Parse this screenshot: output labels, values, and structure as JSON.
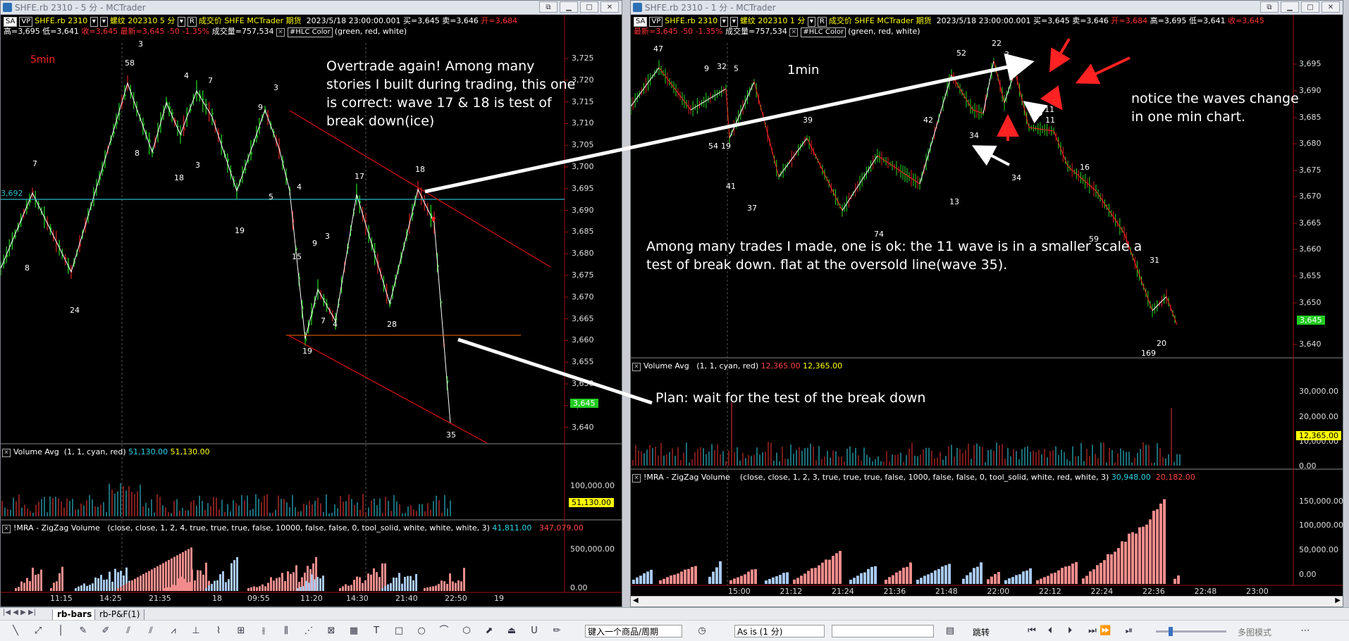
{
  "left_window": {
    "title": "SHFE.rb 2310 - 5 分 - MCTrader",
    "info_row1": [
      "SA",
      "VP",
      "SHFE.rb 2310",
      "螺纹",
      "202310",
      "5 分",
      "R",
      "成交价",
      "SHFE",
      "MCTrader",
      "期货",
      "2023/5/18",
      "23:00:00.001",
      "买=3,645",
      "卖=3,646",
      "开=3,684"
    ],
    "info_row2": {
      "high": "高=3,695",
      "low": "低=3,641",
      "close": "收=3,645",
      "last": "最新=3,645",
      "chg": "-50",
      "pct": "-1.35%",
      "vol": "成交量=757,534",
      "hlc": "#HLC Color",
      "hlc_args": "(green, red, white)"
    },
    "timeframe_label": "5min",
    "y_ticks": [
      "3,725",
      "3,720",
      "3,715",
      "3,710",
      "3,705",
      "3,700",
      "3,695",
      "3,690",
      "3,685",
      "3,680",
      "3,675",
      "3,670",
      "3,665",
      "3,660",
      "3,655",
      "3,650",
      "3,645",
      "3,640"
    ],
    "price_badge": "3,645",
    "cyan_label": "3,692",
    "annotation": "Overtrade again! Among many stories I built during trading, this one is correct: wave 17 & 18 is test of break down(ice)",
    "wave_labels": [
      "58",
      "3",
      "4",
      "7",
      "3",
      "9",
      "7",
      "8",
      "18",
      "3",
      "5",
      "4",
      "17",
      "18",
      "3",
      "19",
      "15",
      "9",
      "8",
      "24",
      "7",
      "4",
      "28",
      "19",
      "35"
    ],
    "volume_header": {
      "name": "Volume Avg",
      "args": "(1, 1, cyan, red)",
      "v1": "51,130.00",
      "v2": "51,130.00"
    },
    "volume_ticks": [
      "100,000.00",
      "0.00"
    ],
    "volume_badge": "51,130.00",
    "zigzag_header": {
      "name": "!MRA - ZigZag Volume",
      "args": "(close, close, 1, 2, 4, true, true, true, false, 10000, false, false, 0, tool_solid, white, white, white, 3)",
      "v1": "41,811.00",
      "v2": "347,079.00"
    },
    "zigzag_ticks": [
      "500,000.00",
      "0.00"
    ],
    "x_ticks": [
      "11:15",
      "14:25",
      "21:35",
      "18",
      "09:55",
      "11:20",
      "14:30",
      "21:40",
      "22:50",
      "19"
    ]
  },
  "right_window": {
    "title": "SHFE.rb 2310 - 1 分 - MCTrader",
    "info_row1": [
      "SA",
      "VP",
      "SHFE.rb 2310",
      "螺纹",
      "202310",
      "1 分",
      "R",
      "成交价",
      "SHFE",
      "MCTrader",
      "期货",
      "2023/5/18",
      "23:00:00.001",
      "买=3,645",
      "卖=3,646",
      "开=3,684",
      "高=3,695",
      "低=3,641",
      "收=3,645"
    ],
    "info_row2": {
      "last": "最新=3,645",
      "chg": "-50",
      "pct": "-1.35%",
      "vol": "成交量=757,534",
      "hlc": "#HLC Color",
      "hlc_args": "(green, red, white)"
    },
    "timeframe_label": "1min",
    "y_ticks": [
      "3,695",
      "3,690",
      "3,685",
      "3,680",
      "3,675",
      "3,670",
      "3,665",
      "3,660",
      "3,655",
      "3,650",
      "3,640"
    ],
    "price_badge": "3,645",
    "annotation_main": "Among many trades I made, one is ok: the 11 wave is in a smaller scale a test of break down. flat at the oversold line(wave 35).",
    "annotation_side": "notice the waves change in one min chart.",
    "annotation_plan": "Plan: wait for the test of the break down",
    "wave_labels": [
      "47",
      "9",
      "32",
      "5",
      "39",
      "54",
      "19",
      "41",
      "37",
      "74",
      "42",
      "52",
      "13",
      "22",
      "3",
      "34",
      "11",
      "11",
      "34",
      "16",
      "59",
      "31",
      "20",
      "169"
    ],
    "volume_header": {
      "name": "Volume Avg",
      "args": "(1, 1, cyan, red)",
      "v1": "12,365.00",
      "v2": "12,365.00"
    },
    "volume_ticks": [
      "30,000.00",
      "20,000.00",
      "10,000.00",
      "0.00"
    ],
    "volume_badge": "12,365.00",
    "zigzag_header": {
      "name": "!MRA - ZigZag Volume",
      "args": "(close, close, 1, 2, 3, true, true, true, false, 1000, false, false, 0, tool_solid, white, red, white, 3)",
      "v1": "30,948.00",
      "v2": "20,182.00"
    },
    "zigzag_ticks": [
      "150,000.00",
      "100,000.00",
      "50,000.00",
      "0.00"
    ],
    "x_ticks": [
      "15:00",
      "21:12",
      "21:24",
      "21:36",
      "21:48",
      "22:00",
      "22:12",
      "22:24",
      "22:36",
      "22:48",
      "23:00"
    ]
  },
  "tabs": [
    "rb-bars",
    "rb-P&F(1)"
  ],
  "toolbar": {
    "symbol_combo": "键入一个商品/周期",
    "scale_combo": "As is (1 分)",
    "jump": "跳转",
    "multiview": "多图模式"
  },
  "colors": {
    "up": "#22dd22",
    "down": "#dd2222",
    "cyan": "#2bb7c7",
    "accent": "#ff2222"
  }
}
